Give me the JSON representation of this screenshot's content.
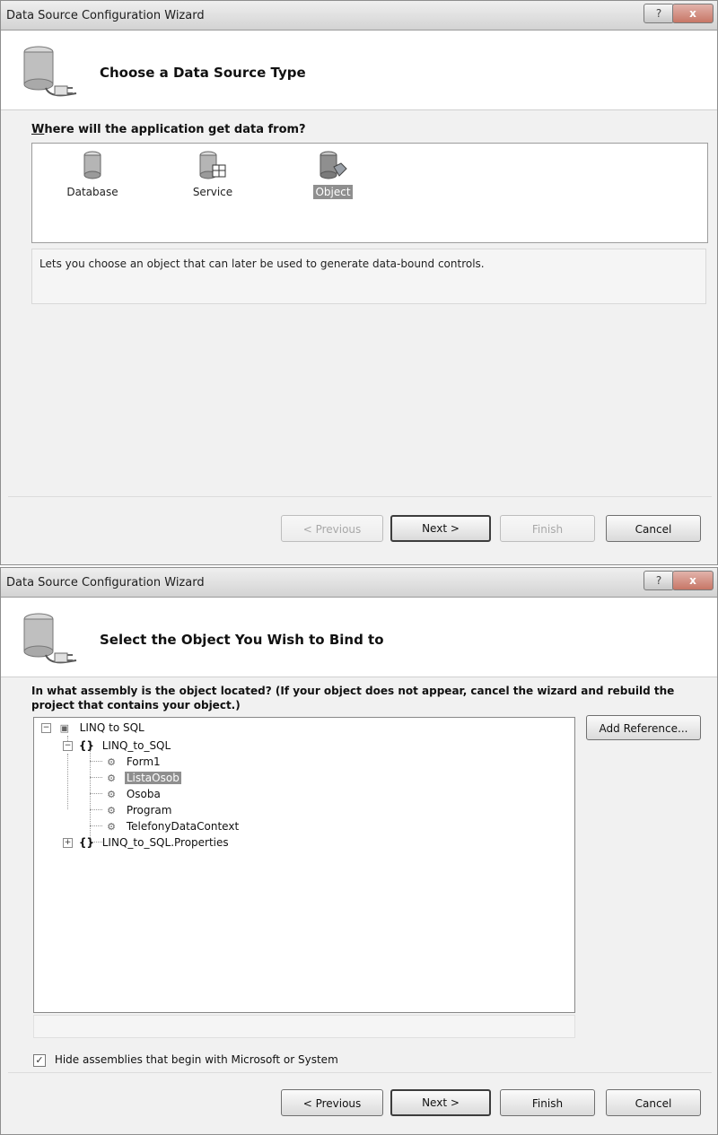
{
  "window1": {
    "title": "Data Source Configuration Wizard",
    "help_label": "?",
    "close_label": "x",
    "header_title": "Choose a Data Source Type",
    "prompt_mnemonic": "W",
    "prompt_rest": "here will the application get data from?",
    "types": [
      {
        "label": "Database",
        "icon": "database-icon",
        "selected": false
      },
      {
        "label": "Service",
        "icon": "service-icon",
        "selected": false
      },
      {
        "label": "Object",
        "icon": "object-icon",
        "selected": true
      }
    ],
    "description": "Lets you choose an object that can later be used to generate data-bound controls.",
    "buttons": {
      "previous": "< Previous",
      "next": "Next >",
      "finish": "Finish",
      "cancel": "Cancel"
    }
  },
  "window2": {
    "title": "Data Source Configuration Wizard",
    "help_label": "?",
    "close_label": "x",
    "header_title": "Select the Object You Wish to Bind to",
    "prompt_line1": "In what assembly is the object located? (If your object does not appear, cancel the wizard and rebuild the",
    "prompt_line2": "project that contains your object.)",
    "add_reference": "Add Reference...",
    "tree": {
      "root": "LINQ to SQL",
      "namespace": "LINQ_to_SQL",
      "classes": [
        "Form1",
        "ListaOsob",
        "Osoba",
        "Program",
        "TelefonyDataContext"
      ],
      "selected": "ListaOsob",
      "namespace2": "LINQ_to_SQL.Properties"
    },
    "checkbox_label": "Hide assemblies that begin with Microsoft or System",
    "checkbox_checked": true,
    "buttons": {
      "previous": "< Previous",
      "next": "Next >",
      "finish": "Finish",
      "cancel": "Cancel"
    }
  }
}
